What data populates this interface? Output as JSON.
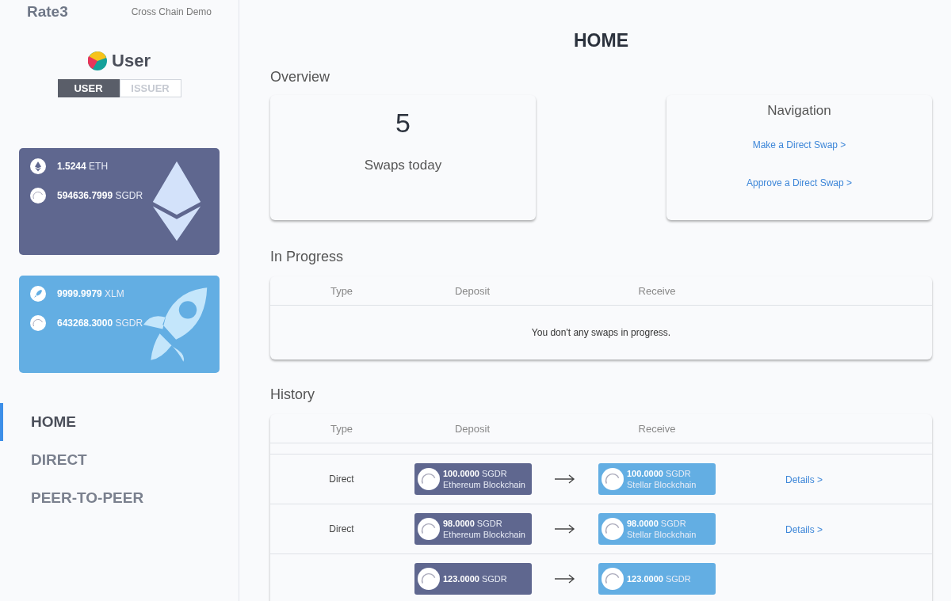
{
  "header": {
    "logo": "Rate3",
    "subtitle": "Cross Chain Demo"
  },
  "profile": {
    "title": "User",
    "roles": [
      {
        "label": "USER",
        "selected": true
      },
      {
        "label": "ISSUER",
        "selected": false
      }
    ]
  },
  "wallets": [
    {
      "kind": "eth",
      "balances": [
        {
          "amount": "1.5244",
          "unit": "ETH"
        },
        {
          "amount": "594636.7999",
          "unit": "SGDR"
        }
      ]
    },
    {
      "kind": "xlm",
      "balances": [
        {
          "amount": "9999.9979",
          "unit": "XLM"
        },
        {
          "amount": "643268.3000",
          "unit": "SGDR"
        }
      ]
    }
  ],
  "nav": [
    {
      "label": "HOME",
      "selected": true
    },
    {
      "label": "DIRECT",
      "selected": false
    },
    {
      "label": "PEER-TO-PEER",
      "selected": false
    }
  ],
  "page_title": "HOME",
  "overview": {
    "heading": "Overview",
    "count": "5",
    "count_label": "Swaps today",
    "navigation": {
      "title": "Navigation",
      "links": [
        "Make a Direct Swap >",
        "Approve a Direct Swap >"
      ]
    }
  },
  "in_progress": {
    "heading": "In Progress",
    "columns": [
      "Type",
      "Deposit",
      "Receive"
    ],
    "empty_message": "You don't any swaps in progress."
  },
  "history": {
    "heading": "History",
    "columns": [
      "Type",
      "Deposit",
      "Receive"
    ],
    "rows": [
      {
        "type": "Direct",
        "deposit": {
          "amount": "100.0000",
          "unit": "SGDR",
          "chain": "Ethereum Blockchain"
        },
        "receive": {
          "amount": "100.0000",
          "unit": "SGDR",
          "chain": "Stellar Blockchain"
        },
        "link": "Details >"
      },
      {
        "type": "Direct",
        "deposit": {
          "amount": "98.0000",
          "unit": "SGDR",
          "chain": "Ethereum Blockchain"
        },
        "receive": {
          "amount": "98.0000",
          "unit": "SGDR",
          "chain": "Stellar Blockchain"
        },
        "link": "Details >"
      },
      {
        "deposit": {
          "amount": "123.0000",
          "unit": "SGDR"
        },
        "receive": {
          "amount": "123.0000",
          "unit": "SGDR"
        }
      }
    ]
  }
}
